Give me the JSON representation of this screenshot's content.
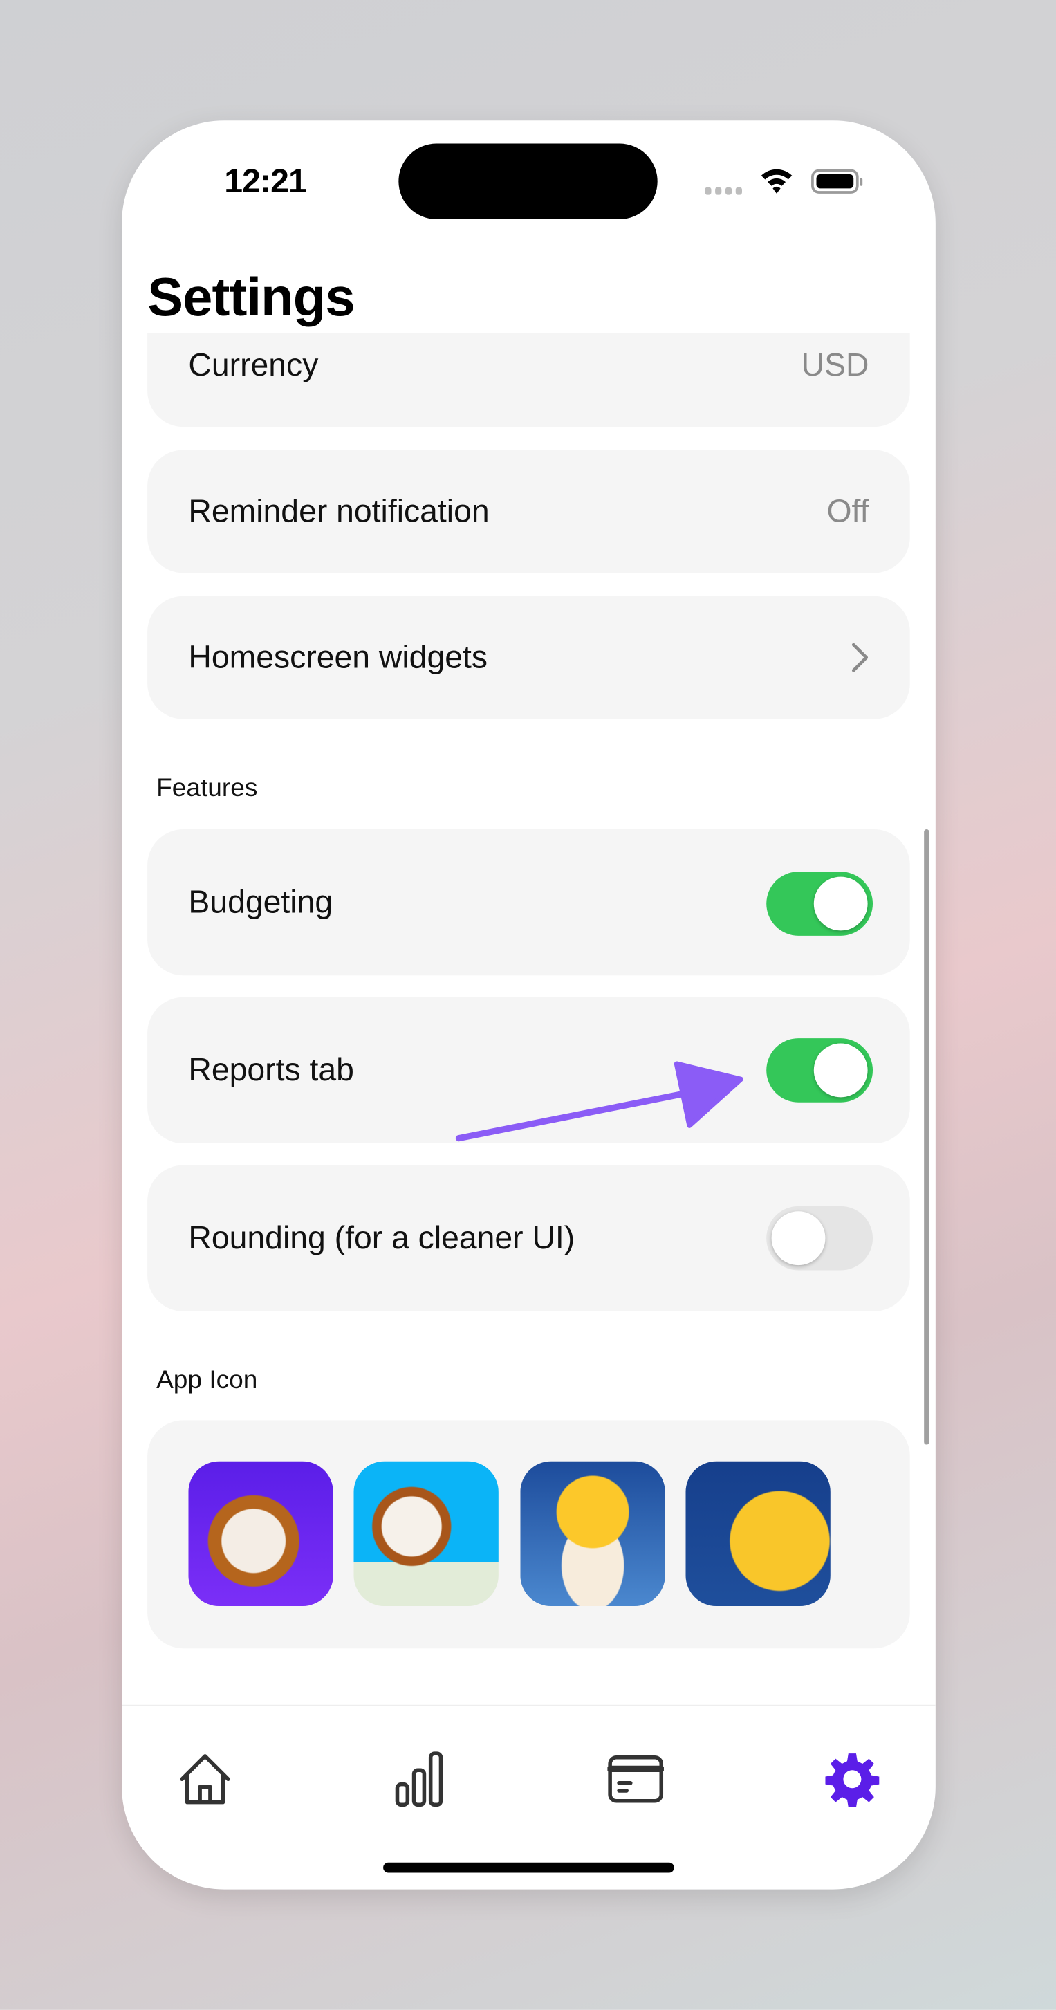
{
  "status_bar": {
    "time": "12:21",
    "wifi_icon": "wifi-icon",
    "battery_icon": "battery-icon"
  },
  "header": {
    "title": "Settings"
  },
  "general": [
    {
      "label": "Currency",
      "value": "USD"
    },
    {
      "label": "Reminder notification",
      "value": "Off"
    },
    {
      "label": "Homescreen widgets",
      "icon": "chevron-right-icon"
    }
  ],
  "features": {
    "heading": "Features",
    "items": [
      {
        "label": "Budgeting",
        "enabled": true
      },
      {
        "label": "Reports tab",
        "enabled": true
      },
      {
        "label": "Rounding (for a cleaner UI)",
        "enabled": false
      }
    ]
  },
  "app_icon": {
    "heading": "App Icon",
    "icons": [
      "dog-purple-icon",
      "dog-keyboard-icon",
      "dog-moon-sleeping-icon",
      "dog-crescent-moon-icon"
    ]
  },
  "tab_bar": {
    "items": [
      {
        "icon": "home-icon",
        "active": false
      },
      {
        "icon": "reports-chart-icon",
        "active": false
      },
      {
        "icon": "card-icon",
        "active": false
      },
      {
        "icon": "gear-icon",
        "active": true
      }
    ]
  },
  "colors": {
    "accent": "#5b1ee8",
    "toggle_on": "#34c759",
    "annotation_arrow": "#8b5cf6"
  }
}
